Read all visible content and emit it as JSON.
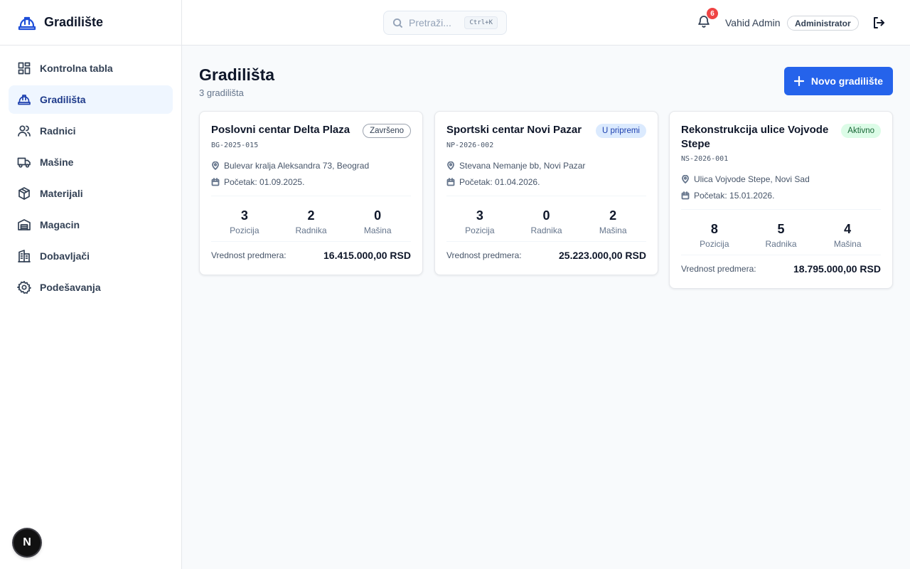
{
  "app": {
    "name": "Gradilište"
  },
  "sidebar": {
    "items": [
      {
        "label": "Kontrolna tabla",
        "icon": "dashboard-icon"
      },
      {
        "label": "Gradilišta",
        "icon": "hard-hat-icon",
        "active": true
      },
      {
        "label": "Radnici",
        "icon": "users-icon"
      },
      {
        "label": "Mašine",
        "icon": "truck-icon"
      },
      {
        "label": "Materijali",
        "icon": "box-icon"
      },
      {
        "label": "Magacin",
        "icon": "warehouse-icon"
      },
      {
        "label": "Dobavljači",
        "icon": "building-icon"
      },
      {
        "label": "Podešavanja",
        "icon": "settings-icon"
      }
    ],
    "dev_badge": "N"
  },
  "topbar": {
    "search_placeholder": "Pretraži...",
    "search_shortcut": "Ctrl+K",
    "notification_count": "6",
    "user_name": "Vahid Admin",
    "user_role": "Administrator"
  },
  "main": {
    "title": "Gradilišta",
    "subtitle": "3 gradilišta",
    "new_button_label": "Novo gradilište",
    "cards": [
      {
        "title": "Poslovni centar Delta Plaza",
        "status": "Završeno",
        "code": "BG-2025-015",
        "address": "Bulevar kralja Aleksandra 73, Beograd",
        "start": "Početak: 01.09.2025.",
        "positions": "3",
        "positions_label": "Pozicija",
        "workers": "2",
        "workers_label": "Radnika",
        "machines": "0",
        "machines_label": "Mašina",
        "value_label": "Vrednost predmera:",
        "value": "16.415.000,00 RSD"
      },
      {
        "title": "Sportski centar Novi Pazar",
        "status": "U pripremi",
        "code": "NP-2026-002",
        "address": "Stevana Nemanje bb, Novi Pazar",
        "start": "Početak: 01.04.2026.",
        "positions": "3",
        "positions_label": "Pozicija",
        "workers": "0",
        "workers_label": "Radnika",
        "machines": "2",
        "machines_label": "Mašina",
        "value_label": "Vrednost predmera:",
        "value": "25.223.000,00 RSD"
      },
      {
        "title": "Rekonstrukcija ulice Vojvode Stepe",
        "status": "Aktivno",
        "code": "NS-2026-001",
        "address": "Ulica Vojvode Stepe, Novi Sad",
        "start": "Početak: 15.01.2026.",
        "positions": "8",
        "positions_label": "Pozicija",
        "workers": "5",
        "workers_label": "Radnika",
        "machines": "4",
        "machines_label": "Mašina",
        "value_label": "Vrednost predmera:",
        "value": "18.795.000,00 RSD"
      }
    ]
  },
  "colors": {
    "primary": "#2563eb",
    "active_nav_bg": "#eff6ff",
    "notification": "#ef4444",
    "status_active_bg": "#dcfce7",
    "status_prep_bg": "#dbeafe"
  }
}
